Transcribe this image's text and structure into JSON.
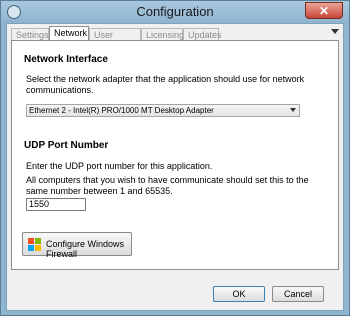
{
  "window": {
    "title": "Configuration",
    "close_label": "✕"
  },
  "tabs": [
    {
      "label": "Settings",
      "active": false
    },
    {
      "label": "Network",
      "active": true
    },
    {
      "label": "User Interface",
      "active": false
    },
    {
      "label": "Licensing",
      "active": false
    },
    {
      "label": "Updates",
      "active": false
    }
  ],
  "network": {
    "heading": "Network Interface",
    "description": "Select the network adapter that the application should use for network communications.",
    "adapter_selected": "Ethernet 2 - Intel(R) PRO/1000 MT Desktop Adapter"
  },
  "udp": {
    "heading": "UDP Port Number",
    "description": "Enter the UDP port number for this application.",
    "note": "All computers that you wish to have communicate should set this to the same number between 1 and 65535.",
    "port_value": "1550"
  },
  "firewall_button": {
    "label": "Configure Windows Firewall"
  },
  "footer": {
    "ok_label": "OK",
    "cancel_label": "Cancel"
  },
  "colors": {
    "logo_red": "#f25022",
    "logo_green": "#7fba00",
    "logo_blue": "#00a4ef",
    "logo_yellow": "#ffb900"
  }
}
